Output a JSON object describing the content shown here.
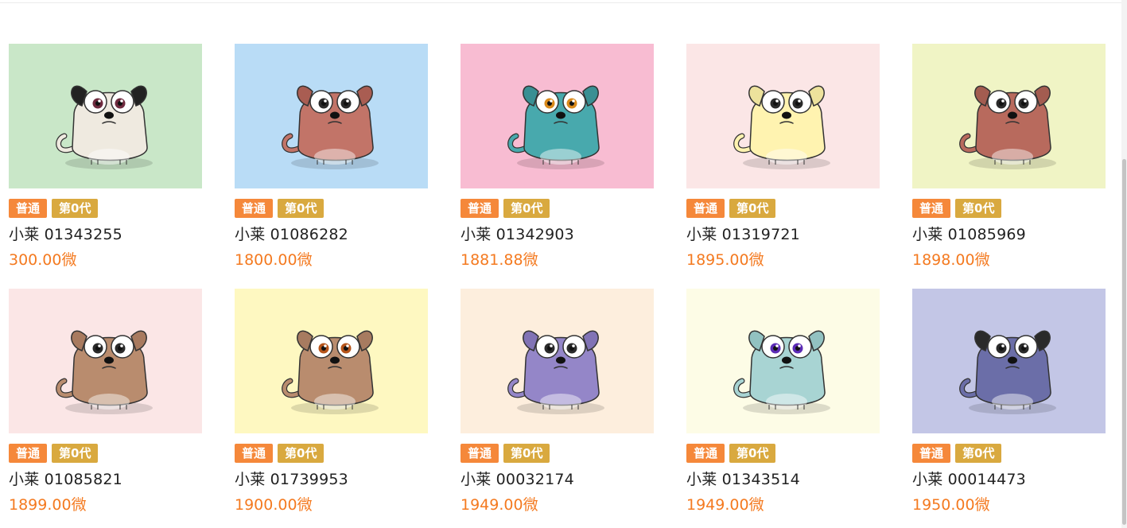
{
  "colors": {
    "tag_rarity": "#f5883a",
    "tag_generation": "#d9a93f",
    "price": "#f47a20"
  },
  "cards": [
    {
      "rarity": "普通",
      "generation": "第0代",
      "name": "小莱 01343255",
      "price": "300.00微",
      "bg": "#c9e7c8",
      "body": "#efeae0",
      "eye": "#6e2a3e",
      "ears": "#222222",
      "icon": "pug-dog-icon"
    },
    {
      "rarity": "普通",
      "generation": "第0代",
      "name": "小莱 01086282",
      "price": "1800.00微",
      "bg": "#b9dcf6",
      "body": "#c27468",
      "eye": "#2a2a2a",
      "ears": "#a95d52",
      "icon": "bulldog-icon"
    },
    {
      "rarity": "普通",
      "generation": "第0代",
      "name": "小莱 01342903",
      "price": "1881.88微",
      "bg": "#f8bcd2",
      "body": "#48a9ad",
      "eye": "#d98a1c",
      "ears": "#3a8f93",
      "icon": "teal-dog-icon"
    },
    {
      "rarity": "普通",
      "generation": "第0代",
      "name": "小莱 01319721",
      "price": "1895.00微",
      "bg": "#fbe6e6",
      "body": "#fff3b0",
      "eye": "#2a2a2a",
      "ears": "#ede29c",
      "icon": "yellow-dog-icon"
    },
    {
      "rarity": "普通",
      "generation": "第0代",
      "name": "小莱 01085969",
      "price": "1898.00微",
      "bg": "#f0f4c5",
      "body": "#b86a5d",
      "eye": "#2a2a2a",
      "ears": "#a35c50",
      "icon": "brown-dog-icon"
    },
    {
      "rarity": "普通",
      "generation": "第0代",
      "name": "小莱 01085821",
      "price": "1899.00微",
      "bg": "#fbe6e6",
      "body": "#b98c6e",
      "eye": "#2a2a2a",
      "ears": "#a87a5f",
      "icon": "chihuahua-icon"
    },
    {
      "rarity": "普通",
      "generation": "第0代",
      "name": "小莱 01739953",
      "price": "1900.00微",
      "bg": "#fef8c1",
      "body": "#b98c6e",
      "eye": "#b5541a",
      "ears": "#a77b60",
      "icon": "tan-dog-icon"
    },
    {
      "rarity": "普通",
      "generation": "第0代",
      "name": "小莱 00032174",
      "price": "1949.00微",
      "bg": "#fdeedd",
      "body": "#9486c8",
      "eye": "#2a2a2a",
      "ears": "#8173b5",
      "icon": "purple-dog-icon"
    },
    {
      "rarity": "普通",
      "generation": "第0代",
      "name": "小莱 01343514",
      "price": "1949.00微",
      "bg": "#fdfce6",
      "body": "#a8d4d3",
      "eye": "#5b2bb5",
      "ears": "#92c2c1",
      "icon": "mint-dog-icon"
    },
    {
      "rarity": "普通",
      "generation": "第0代",
      "name": "小莱 00014473",
      "price": "1950.00微",
      "bg": "#c3c6e6",
      "body": "#6b6ea8",
      "eye": "#2a2a2a",
      "ears": "#2a2a2a",
      "icon": "navy-dog-icon"
    }
  ]
}
